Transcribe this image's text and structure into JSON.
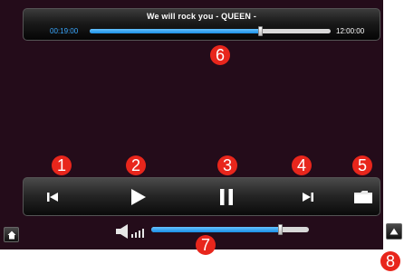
{
  "now_playing": {
    "title": "We will rock you - QUEEN -",
    "elapsed": "00:19:00",
    "total": "12:00:00",
    "progress_fraction": 0.71
  },
  "controls": {
    "items": [
      {
        "name": "previous",
        "icon": "skip-previous-icon"
      },
      {
        "name": "play",
        "icon": "play-icon"
      },
      {
        "name": "pause",
        "icon": "pause-icon"
      },
      {
        "name": "next",
        "icon": "skip-next-icon"
      },
      {
        "name": "folder",
        "icon": "folder-icon"
      }
    ]
  },
  "volume": {
    "level_fraction": 0.82,
    "icon": "speaker-icon"
  },
  "nav": {
    "home_icon": "home-icon",
    "up_icon": "up-arrow-icon"
  },
  "callouts": [
    "1",
    "2",
    "3",
    "4",
    "5",
    "6",
    "7",
    "8"
  ],
  "colors": {
    "background": "#240c1a",
    "accent": "#1a8fe6",
    "elapsed_text": "#3aa8ff",
    "callout": "#e8261c"
  }
}
